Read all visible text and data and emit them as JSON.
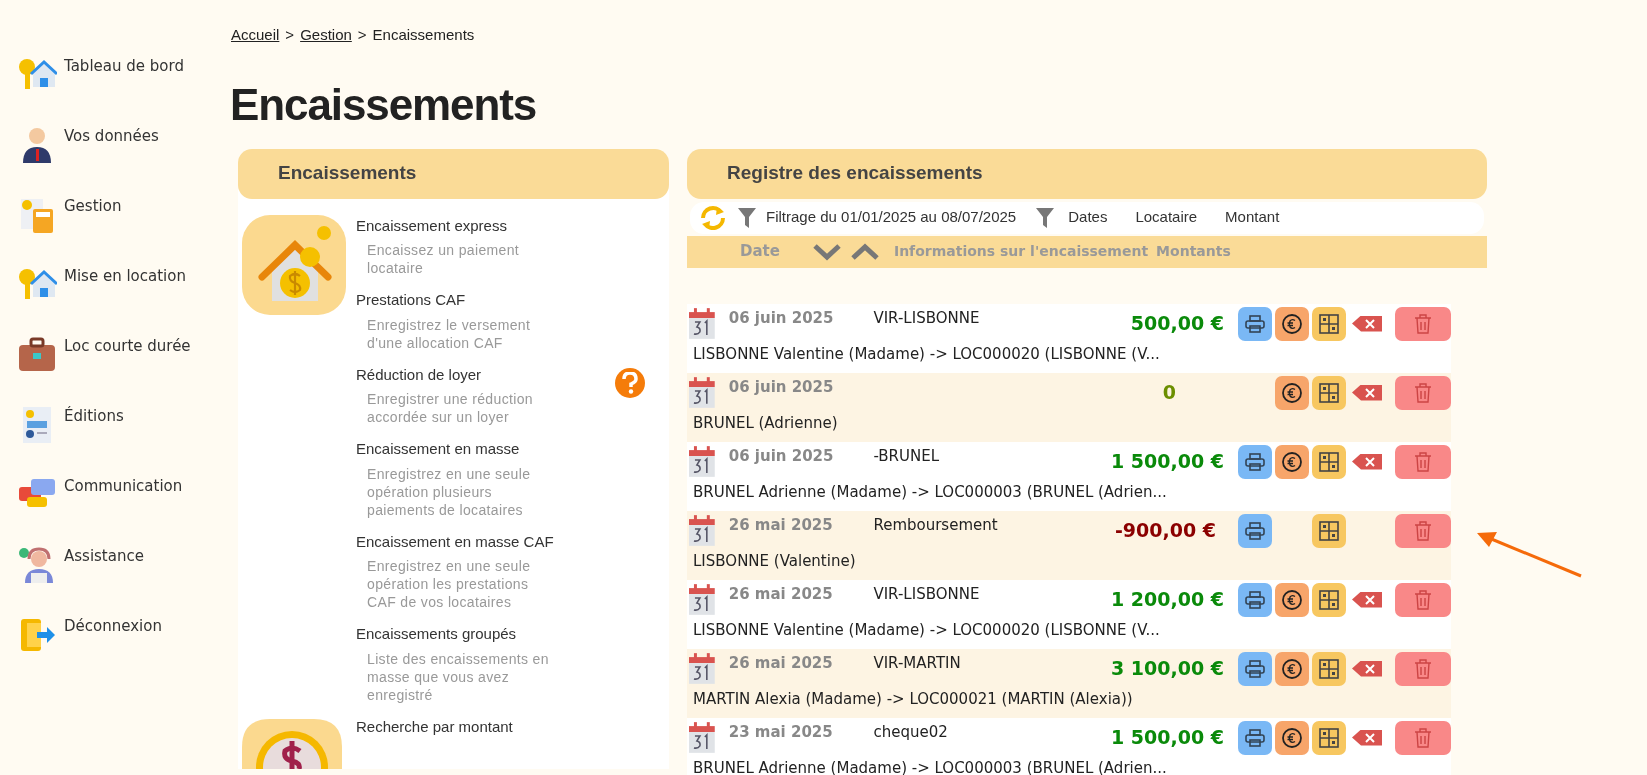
{
  "sidebar": {
    "items": [
      {
        "label": "Tableau de bord"
      },
      {
        "label": "Vos données"
      },
      {
        "label": "Gestion"
      },
      {
        "label": "Mise en location"
      },
      {
        "label": "Loc courte durée"
      },
      {
        "label": "Éditions"
      },
      {
        "label": "Communication"
      },
      {
        "label": "Assistance"
      },
      {
        "label": "Déconnexion"
      }
    ]
  },
  "breadcrumb": [
    {
      "label": "Accueil",
      "link": true
    },
    {
      "label": ">",
      "link": false
    },
    {
      "label": "Gestion",
      "link": true
    },
    {
      "label": ">",
      "link": false
    },
    {
      "label": "Encaissements",
      "link": false
    }
  ],
  "page_title": "Encaissements",
  "actions_panel": {
    "title": "Encaissements",
    "items": [
      {
        "title": "Encaissement express",
        "description": "Encaissez un paiement locataire",
        "help": false
      },
      {
        "title": "Prestations CAF",
        "description": "Enregistrez le versement d'une allocation CAF",
        "help": false
      },
      {
        "title": "Réduction de loyer",
        "description": "Enregistrer une réduction accordée sur un loyer",
        "help": true
      },
      {
        "title": "Encaissement en masse",
        "description": "Enregistrez en une seule opération plusieurs paiements de locataires",
        "help": false
      },
      {
        "title": "Encaissement en masse CAF",
        "description": "Enregistrez en une seule opération les prestations CAF de vos locataires",
        "help": false
      },
      {
        "title": "Encaissements groupés",
        "description": "Liste des encaissements en masse que vous avez enregistré",
        "help": false
      },
      {
        "title": "Recherche par montant",
        "help": false
      }
    ]
  },
  "register": {
    "title": "Registre des encaissements",
    "filter": {
      "text": "Filtrage du 01/01/2025 au 08/07/2025",
      "options": [
        "Dates",
        "Locataire",
        "Montant"
      ]
    },
    "columns": [
      "Date",
      "Informations sur l'encaissement",
      "Montants"
    ],
    "rows": [
      {
        "date": "06 juin 2025",
        "reference": "VIR-LISBONNE",
        "amount": "500,00 €",
        "kind": "positive",
        "description": "LISBONNE Valentine (Madame) -> LOC000020 (LISBONNE (V...",
        "print": true,
        "payment": true,
        "cancel": true
      },
      {
        "date": "06 juin 2025",
        "amount": "0",
        "kind": "zero",
        "description": "BRUNEL (Adrienne)",
        "print": false,
        "payment": true,
        "cancel": true
      },
      {
        "date": "06 juin 2025",
        "reference": "-BRUNEL",
        "amount": "1 500,00 €",
        "kind": "positive",
        "description": "BRUNEL Adrienne (Madame) -> LOC000003 (BRUNEL (Adrien...",
        "print": true,
        "payment": true,
        "cancel": true
      },
      {
        "date": "26 mai 2025",
        "reference": "Remboursement",
        "amount": "-900,00 €",
        "kind": "negative",
        "description": "LISBONNE (Valentine)",
        "print": true,
        "payment": false,
        "cancel": false
      },
      {
        "date": "26 mai 2025",
        "reference": "VIR-LISBONNE",
        "amount": "1 200,00 €",
        "kind": "positive",
        "description": "LISBONNE Valentine (Madame) -> LOC000020 (LISBONNE (V...",
        "print": true,
        "payment": true,
        "cancel": true
      },
      {
        "date": "26 mai 2025",
        "reference": "VIR-MARTIN",
        "amount": "3 100,00 €",
        "kind": "positive",
        "description": "MARTIN Alexia (Madame) -> LOC000021 (MARTIN (Alexia))",
        "print": true,
        "payment": true,
        "cancel": true
      },
      {
        "date": "23 mai 2025",
        "reference": "cheque02",
        "amount": "1 500,00 €",
        "kind": "positive",
        "description": "BRUNEL Adrienne (Madame) -> LOC000003 (BRUNEL (Adrien...",
        "print": true,
        "payment": true,
        "cancel": true
      }
    ]
  }
}
